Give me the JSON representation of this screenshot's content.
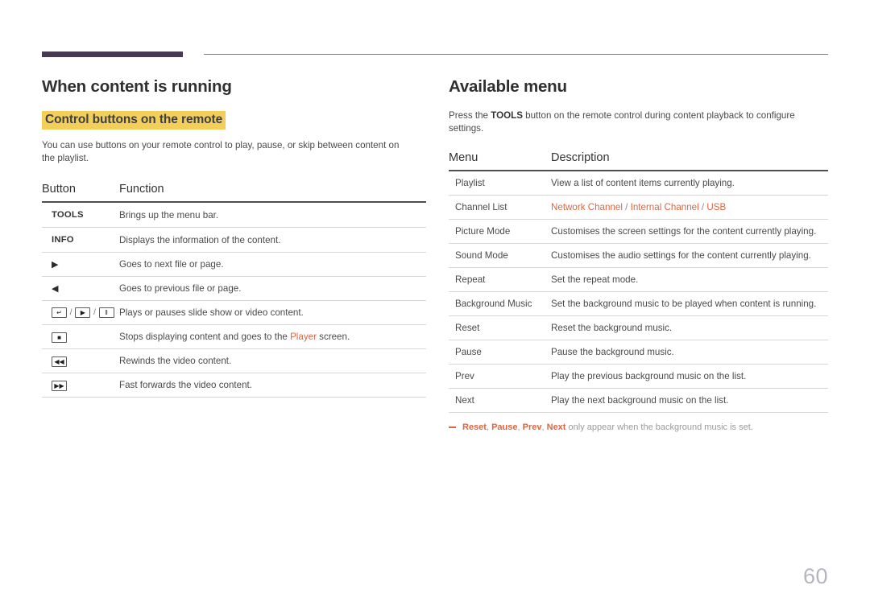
{
  "page": {
    "number": "60",
    "accent_color": "#e2643c",
    "highlight_color": "#f2ce5a",
    "rule_color": "#473a50"
  },
  "left": {
    "section_title": "When content is running",
    "highlight_title": "Control buttons on the remote",
    "intro": "You can use buttons on your remote control to play, pause, or skip between content on the playlist.",
    "table": {
      "headers": [
        "Button",
        "Function"
      ],
      "rows": [
        {
          "button_type": "text",
          "button": "TOOLS",
          "function_pre": "Brings up the menu bar.",
          "function_link": "",
          "function_post": ""
        },
        {
          "button_type": "text",
          "button": "INFO",
          "function_pre": "Displays the information of the content.",
          "function_link": "",
          "function_post": ""
        },
        {
          "button_type": "plain",
          "button": "▶",
          "icon_name": "play-triangle-right-icon",
          "function_pre": "Goes to next file or page.",
          "function_link": "",
          "function_post": ""
        },
        {
          "button_type": "plain",
          "button": "◀",
          "icon_name": "play-triangle-left-icon",
          "function_pre": "Goes to previous file or page.",
          "function_link": "",
          "function_post": ""
        },
        {
          "button_type": "boxgroup",
          "boxes": [
            "↵",
            "▶",
            "‖"
          ],
          "box_names": [
            "enter-key-icon",
            "play-key-icon",
            "pause-key-icon"
          ],
          "separator": "/",
          "function_pre": "Plays or pauses slide show or video content.",
          "function_link": "",
          "function_post": ""
        },
        {
          "button_type": "box",
          "button": "■",
          "icon_name": "stop-key-icon",
          "function_pre": "Stops displaying content and goes to the ",
          "function_link": "Player",
          "function_post": " screen."
        },
        {
          "button_type": "box",
          "button": "◀◀",
          "icon_name": "rewind-key-icon",
          "function_pre": "Rewinds the video content.",
          "function_link": "",
          "function_post": ""
        },
        {
          "button_type": "box",
          "button": "▶▶",
          "icon_name": "fast-forward-key-icon",
          "function_pre": "Fast forwards the video content.",
          "function_link": "",
          "function_post": ""
        }
      ]
    }
  },
  "right": {
    "section_title": "Available menu",
    "intro_pre": "Press the ",
    "intro_key": "TOOLS",
    "intro_post": " button on the remote control during content playback to configure settings.",
    "table": {
      "headers": [
        "Menu",
        "Description"
      ],
      "rows": [
        {
          "menu": "Playlist",
          "desc_parts": [
            {
              "text": "View a list of content items currently playing.",
              "style": "plain"
            }
          ]
        },
        {
          "menu": "Channel List",
          "desc_parts": [
            {
              "text": "Network Channel",
              "style": "link"
            },
            {
              "text": " / ",
              "style": "sep"
            },
            {
              "text": "Internal Channel",
              "style": "link"
            },
            {
              "text": " / ",
              "style": "sep"
            },
            {
              "text": "USB",
              "style": "link"
            }
          ]
        },
        {
          "menu": "Picture Mode",
          "desc_parts": [
            {
              "text": "Customises the screen settings for the content currently playing.",
              "style": "plain"
            }
          ]
        },
        {
          "menu": "Sound Mode",
          "desc_parts": [
            {
              "text": "Customises the audio settings for the content currently playing.",
              "style": "plain"
            }
          ]
        },
        {
          "menu": "Repeat",
          "desc_parts": [
            {
              "text": "Set the repeat mode.",
              "style": "plain"
            }
          ]
        },
        {
          "menu": "Background Music",
          "desc_parts": [
            {
              "text": "Set the background music to be played when content is running.",
              "style": "plain"
            }
          ]
        },
        {
          "menu": "Reset",
          "desc_parts": [
            {
              "text": "Reset the background music.",
              "style": "plain"
            }
          ]
        },
        {
          "menu": "Pause",
          "desc_parts": [
            {
              "text": "Pause the background music.",
              "style": "plain"
            }
          ]
        },
        {
          "menu": "Prev",
          "desc_parts": [
            {
              "text": "Play the previous background music on the list.",
              "style": "plain"
            }
          ]
        },
        {
          "menu": "Next",
          "desc_parts": [
            {
              "text": "Play the next background music on the list.",
              "style": "plain"
            }
          ]
        }
      ]
    },
    "footnote_parts": [
      {
        "text": "Reset",
        "style": "link"
      },
      {
        "text": ", ",
        "style": "plain"
      },
      {
        "text": "Pause",
        "style": "link"
      },
      {
        "text": ", ",
        "style": "plain"
      },
      {
        "text": "Prev",
        "style": "link"
      },
      {
        "text": ", ",
        "style": "plain"
      },
      {
        "text": "Next",
        "style": "link"
      },
      {
        "text": " only appear when the background music is set.",
        "style": "plain"
      }
    ]
  }
}
